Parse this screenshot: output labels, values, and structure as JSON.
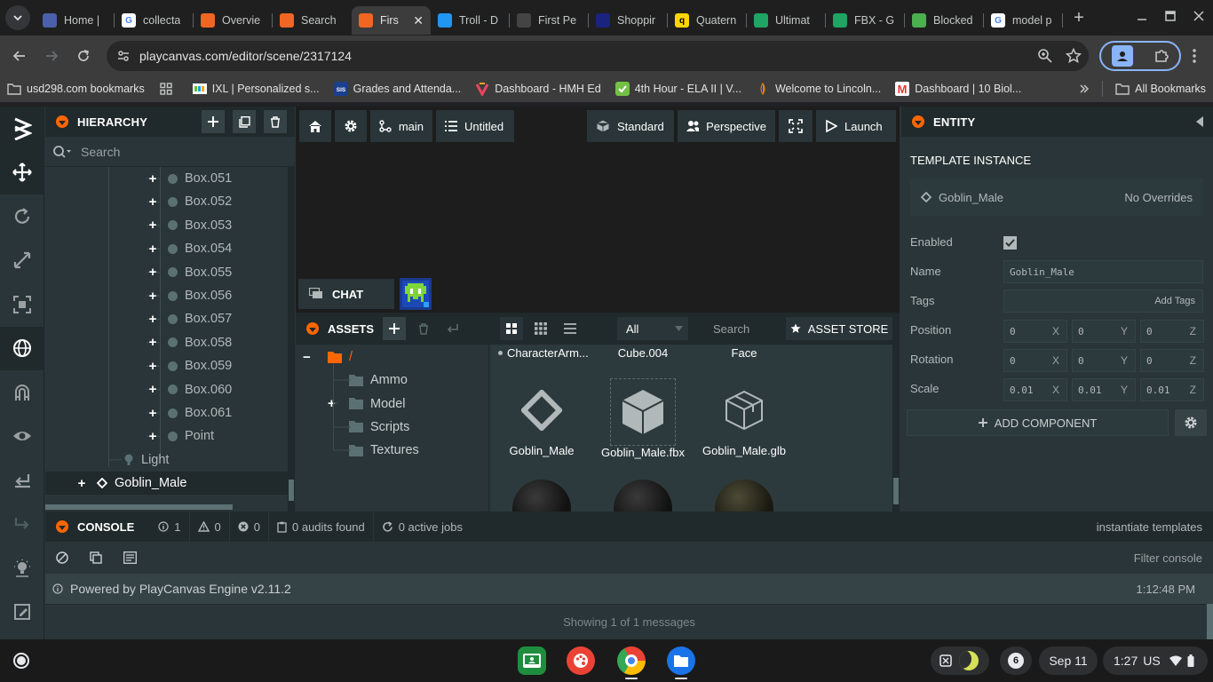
{
  "browser": {
    "tabs": [
      {
        "title": "Home |",
        "fav_color": "#4a60a8",
        "fav_text": "",
        "active": false
      },
      {
        "title": "collecta",
        "fav_color": "#ffffff",
        "fav_text": "G",
        "active": false
      },
      {
        "title": "Overvie",
        "fav_color": "#f26522",
        "fav_text": "",
        "active": false
      },
      {
        "title": "Search",
        "fav_color": "#f26522",
        "fav_text": "",
        "active": false
      },
      {
        "title": "Firs",
        "fav_color": "#f26522",
        "fav_text": "",
        "active": true
      },
      {
        "title": "Troll - D",
        "fav_color": "#2196f3",
        "fav_text": "",
        "active": false
      },
      {
        "title": "First Pe",
        "fav_color": "#444444",
        "fav_text": "",
        "active": false
      },
      {
        "title": "Shoppir",
        "fav_color": "#1a237e",
        "fav_text": "",
        "active": false
      },
      {
        "title": "Quatern",
        "fav_color": "#ffd600",
        "fav_text": "q",
        "active": false
      },
      {
        "title": "Ultimat",
        "fav_color": "#1fa463",
        "fav_text": "",
        "active": false
      },
      {
        "title": "FBX - G",
        "fav_color": "#1fa463",
        "fav_text": "",
        "active": false
      },
      {
        "title": "Blocked",
        "fav_color": "#4caf50",
        "fav_text": "",
        "active": false
      },
      {
        "title": "model p",
        "fav_color": "#ffffff",
        "fav_text": "G",
        "active": false
      }
    ],
    "url": "playcanvas.com/editor/scene/2317124",
    "bookmarks": [
      {
        "label": "usd298.com bookmarks",
        "icon": "folder-icon"
      },
      {
        "label": "",
        "icon": "apps-grid-icon"
      },
      {
        "label": "IXL | Personalized s...",
        "icon": "ixl-icon"
      },
      {
        "label": "Grades and Attenda...",
        "icon": "sis-icon"
      },
      {
        "label": "Dashboard - HMH Ed",
        "icon": "hmh-icon"
      },
      {
        "label": "4th Hour - ELA II | V...",
        "icon": "check-icon"
      },
      {
        "label": "Welcome to Lincoln...",
        "icon": "lincoln-icon"
      },
      {
        "label": "Dashboard | 10 Biol...",
        "icon": "m-icon"
      }
    ],
    "all_bookmarks": "All Bookmarks"
  },
  "hierarchy": {
    "title": "HIERARCHY",
    "search_placeholder": "Search",
    "items": [
      {
        "label": "Box.051",
        "expandable": true,
        "type": "dot"
      },
      {
        "label": "Box.052",
        "expandable": true,
        "type": "dot"
      },
      {
        "label": "Box.053",
        "expandable": true,
        "type": "dot"
      },
      {
        "label": "Box.054",
        "expandable": true,
        "type": "dot"
      },
      {
        "label": "Box.055",
        "expandable": true,
        "type": "dot"
      },
      {
        "label": "Box.056",
        "expandable": true,
        "type": "dot"
      },
      {
        "label": "Box.057",
        "expandable": true,
        "type": "dot"
      },
      {
        "label": "Box.058",
        "expandable": true,
        "type": "dot"
      },
      {
        "label": "Box.059",
        "expandable": true,
        "type": "dot"
      },
      {
        "label": "Box.060",
        "expandable": true,
        "type": "dot"
      },
      {
        "label": "Box.061",
        "expandable": true,
        "type": "dot"
      },
      {
        "label": "Point",
        "expandable": true,
        "type": "dot"
      },
      {
        "label": "Light",
        "expandable": false,
        "type": "light"
      },
      {
        "label": "Goblin_Male",
        "expandable": true,
        "type": "template"
      }
    ]
  },
  "viewport": {
    "branch": "main",
    "scene": "Untitled",
    "render_mode": "Standard",
    "camera": "Perspective",
    "launch": "Launch",
    "chat": "CHAT"
  },
  "assets": {
    "title": "ASSETS",
    "filter": "All",
    "search_placeholder": "Search",
    "store": "ASSET STORE",
    "folders": [
      {
        "label": "/",
        "expand": "−"
      },
      {
        "label": "Ammo",
        "expand": ""
      },
      {
        "label": "Model",
        "expand": "+"
      },
      {
        "label": "Scripts",
        "expand": ""
      },
      {
        "label": "Textures",
        "expand": ""
      }
    ],
    "top_row": [
      "CharacterArm...",
      "Cube.004",
      "Face"
    ],
    "items": [
      {
        "label": "Goblin_Male",
        "kind": "template"
      },
      {
        "label": "Goblin_Male.fbx",
        "kind": "fbx"
      },
      {
        "label": "Goblin_Male.glb",
        "kind": "glb"
      }
    ]
  },
  "entity": {
    "title": "ENTITY",
    "section": "TEMPLATE INSTANCE",
    "template_name": "Goblin_Male",
    "overrides": "No Overrides",
    "labels": {
      "enabled": "Enabled",
      "name": "Name",
      "tags": "Tags",
      "position": "Position",
      "rotation": "Rotation",
      "scale": "Scale"
    },
    "name_value": "Goblin_Male",
    "tags_placeholder": "Add Tags",
    "position": [
      "0",
      "0",
      "0"
    ],
    "rotation": [
      "0",
      "0",
      "0"
    ],
    "scale": [
      "0.01",
      "0.01",
      "0.01"
    ],
    "axes": [
      "X",
      "Y",
      "Z"
    ],
    "add_component": "ADD COMPONENT"
  },
  "console": {
    "title": "CONSOLE",
    "info_count": "1",
    "warn_count": "0",
    "error_count": "0",
    "audits": "0 audits found",
    "jobs": "0 active jobs",
    "action": "instantiate templates",
    "filter": "Filter console",
    "message": "Powered by PlayCanvas Engine v2.11.2",
    "time": "1:12:48 PM",
    "footer": "Showing 1 of 1 messages"
  },
  "shelf": {
    "notifications": "6",
    "date": "Sep 11",
    "time": "1:27",
    "locale": "US"
  }
}
